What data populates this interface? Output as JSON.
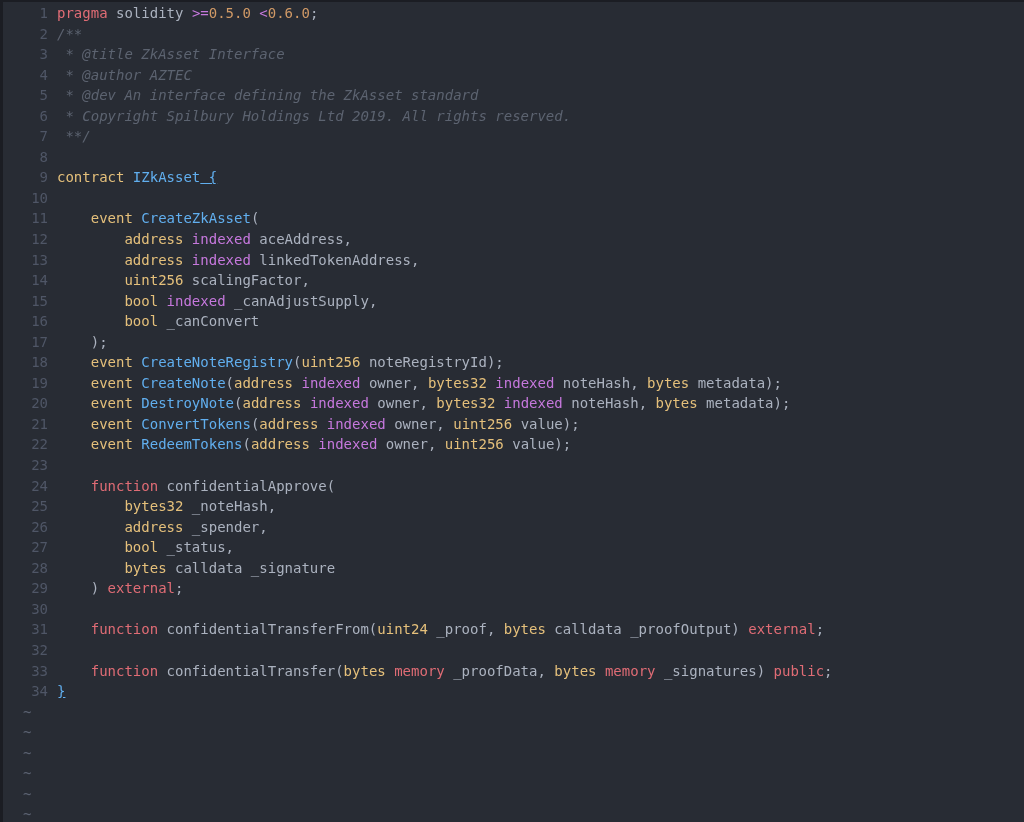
{
  "editor": {
    "lines": [
      {
        "number": "1",
        "tokens": [
          {
            "text": "pragma",
            "kind": "kw"
          },
          {
            "text": " solidity ",
            "kind": "plain"
          },
          {
            "text": ">=",
            "kind": "op"
          },
          {
            "text": "0.5.0",
            "kind": "num"
          },
          {
            "text": " <",
            "kind": "op"
          },
          {
            "text": "0.6.0",
            "kind": "num"
          },
          {
            "text": ";",
            "kind": "plain"
          }
        ]
      },
      {
        "number": "2",
        "tokens": [
          {
            "text": "/**",
            "kind": "comment"
          }
        ]
      },
      {
        "number": "3",
        "tokens": [
          {
            "text": " * @title ZkAsset Interface",
            "kind": "comment"
          }
        ]
      },
      {
        "number": "4",
        "tokens": [
          {
            "text": " * @author AZTEC",
            "kind": "comment"
          }
        ]
      },
      {
        "number": "5",
        "tokens": [
          {
            "text": " * @dev An interface defining the ZkAsset standard",
            "kind": "comment"
          }
        ]
      },
      {
        "number": "6",
        "tokens": [
          {
            "text": " * Copyright Spilbury Holdings Ltd 2019. All rights reserved.",
            "kind": "comment"
          }
        ]
      },
      {
        "number": "7",
        "tokens": [
          {
            "text": " **/",
            "kind": "comment"
          }
        ]
      },
      {
        "number": "8"
      },
      {
        "number": "9",
        "tokens": [
          {
            "text": "contract",
            "kind": "type"
          },
          {
            "text": " IZkAsset",
            "kind": "fn"
          },
          {
            "text": " {",
            "kind": "brace"
          }
        ]
      },
      {
        "number": "10"
      },
      {
        "number": "11",
        "tokens": [
          {
            "text": "    event",
            "kind": "type"
          },
          {
            "text": " CreateZkAsset",
            "kind": "fn"
          },
          {
            "text": "(",
            "kind": "plain"
          }
        ]
      },
      {
        "number": "12",
        "tokens": [
          {
            "text": "        address",
            "kind": "type"
          },
          {
            "text": " indexed",
            "kind": "mod"
          },
          {
            "text": " aceAddress,",
            "kind": "plain"
          }
        ]
      },
      {
        "number": "13",
        "tokens": [
          {
            "text": "        address",
            "kind": "type"
          },
          {
            "text": " indexed",
            "kind": "mod"
          },
          {
            "text": " linkedTokenAddress,",
            "kind": "plain"
          }
        ]
      },
      {
        "number": "14",
        "tokens": [
          {
            "text": "        uint256",
            "kind": "type"
          },
          {
            "text": " scalingFactor,",
            "kind": "plain"
          }
        ]
      },
      {
        "number": "15",
        "tokens": [
          {
            "text": "        bool",
            "kind": "type"
          },
          {
            "text": " indexed",
            "kind": "mod"
          },
          {
            "text": " _canAdjustSupply,",
            "kind": "plain"
          }
        ]
      },
      {
        "number": "16",
        "tokens": [
          {
            "text": "        bool",
            "kind": "type"
          },
          {
            "text": " _canConvert",
            "kind": "plain"
          }
        ]
      },
      {
        "number": "17",
        "tokens": [
          {
            "text": "    );",
            "kind": "plain"
          }
        ]
      },
      {
        "number": "18",
        "tokens": [
          {
            "text": "    event",
            "kind": "type"
          },
          {
            "text": " CreateNoteRegistry",
            "kind": "fn"
          },
          {
            "text": "(",
            "kind": "plain"
          },
          {
            "text": "uint256",
            "kind": "type"
          },
          {
            "text": " noteRegistryId);",
            "kind": "plain"
          }
        ]
      },
      {
        "number": "19",
        "tokens": [
          {
            "text": "    event",
            "kind": "type"
          },
          {
            "text": " CreateNote",
            "kind": "fn"
          },
          {
            "text": "(",
            "kind": "plain"
          },
          {
            "text": "address",
            "kind": "type"
          },
          {
            "text": " indexed",
            "kind": "mod"
          },
          {
            "text": " owner, ",
            "kind": "plain"
          },
          {
            "text": "bytes32",
            "kind": "type"
          },
          {
            "text": " indexed",
            "kind": "mod"
          },
          {
            "text": " noteHash, ",
            "kind": "plain"
          },
          {
            "text": "bytes",
            "kind": "type"
          },
          {
            "text": " metadata);",
            "kind": "plain"
          }
        ]
      },
      {
        "number": "20",
        "tokens": [
          {
            "text": "    event",
            "kind": "type"
          },
          {
            "text": " DestroyNote",
            "kind": "fn"
          },
          {
            "text": "(",
            "kind": "plain"
          },
          {
            "text": "address",
            "kind": "type"
          },
          {
            "text": " indexed",
            "kind": "mod"
          },
          {
            "text": " owner, ",
            "kind": "plain"
          },
          {
            "text": "bytes32",
            "kind": "type"
          },
          {
            "text": " indexed",
            "kind": "mod"
          },
          {
            "text": " noteHash, ",
            "kind": "plain"
          },
          {
            "text": "bytes",
            "kind": "type"
          },
          {
            "text": " metadata);",
            "kind": "plain"
          }
        ]
      },
      {
        "number": "21",
        "tokens": [
          {
            "text": "    event",
            "kind": "type"
          },
          {
            "text": " ConvertTokens",
            "kind": "fn"
          },
          {
            "text": "(",
            "kind": "plain"
          },
          {
            "text": "address",
            "kind": "type"
          },
          {
            "text": " indexed",
            "kind": "mod"
          },
          {
            "text": " owner, ",
            "kind": "plain"
          },
          {
            "text": "uint256",
            "kind": "type"
          },
          {
            "text": " value);",
            "kind": "plain"
          }
        ]
      },
      {
        "number": "22",
        "tokens": [
          {
            "text": "    event",
            "kind": "type"
          },
          {
            "text": " RedeemTokens",
            "kind": "fn"
          },
          {
            "text": "(",
            "kind": "plain"
          },
          {
            "text": "address",
            "kind": "type"
          },
          {
            "text": " indexed",
            "kind": "mod"
          },
          {
            "text": " owner, ",
            "kind": "plain"
          },
          {
            "text": "uint256",
            "kind": "type"
          },
          {
            "text": " value);",
            "kind": "plain"
          }
        ]
      },
      {
        "number": "23"
      },
      {
        "number": "24",
        "tokens": [
          {
            "text": "    function",
            "kind": "kw"
          },
          {
            "text": " confidentialApprove(",
            "kind": "plain"
          }
        ]
      },
      {
        "number": "25",
        "tokens": [
          {
            "text": "        bytes32",
            "kind": "type"
          },
          {
            "text": " _noteHash,",
            "kind": "plain"
          }
        ]
      },
      {
        "number": "26",
        "tokens": [
          {
            "text": "        address",
            "kind": "type"
          },
          {
            "text": " _spender,",
            "kind": "plain"
          }
        ]
      },
      {
        "number": "27",
        "tokens": [
          {
            "text": "        bool",
            "kind": "type"
          },
          {
            "text": " _status,",
            "kind": "plain"
          }
        ]
      },
      {
        "number": "28",
        "tokens": [
          {
            "text": "        bytes",
            "kind": "type"
          },
          {
            "text": " calldata _signature",
            "kind": "plain"
          }
        ]
      },
      {
        "number": "29",
        "tokens": [
          {
            "text": "    )",
            "kind": "plain"
          },
          {
            "text": " external",
            "kind": "kw"
          },
          {
            "text": ";",
            "kind": "plain"
          }
        ]
      },
      {
        "number": "30"
      },
      {
        "number": "31",
        "tokens": [
          {
            "text": "    function",
            "kind": "kw"
          },
          {
            "text": " confidentialTransferFrom(",
            "kind": "plain"
          },
          {
            "text": "uint24",
            "kind": "type"
          },
          {
            "text": " _proof, ",
            "kind": "plain"
          },
          {
            "text": "bytes",
            "kind": "type"
          },
          {
            "text": " calldata _proofOutput)",
            "kind": "plain"
          },
          {
            "text": " external",
            "kind": "kw"
          },
          {
            "text": ";",
            "kind": "plain"
          }
        ]
      },
      {
        "number": "32"
      },
      {
        "number": "33",
        "tokens": [
          {
            "text": "    function",
            "kind": "kw"
          },
          {
            "text": " confidentialTransfer(",
            "kind": "plain"
          },
          {
            "text": "bytes",
            "kind": "type"
          },
          {
            "text": " memory",
            "kind": "kw"
          },
          {
            "text": " _proofData, ",
            "kind": "plain"
          },
          {
            "text": "bytes",
            "kind": "type"
          },
          {
            "text": " memory",
            "kind": "kw"
          },
          {
            "text": " _signatures)",
            "kind": "plain"
          },
          {
            "text": " public",
            "kind": "kw"
          },
          {
            "text": ";",
            "kind": "plain"
          }
        ]
      },
      {
        "number": "34",
        "tokens": [
          {
            "text": "}",
            "kind": "brace"
          }
        ]
      }
    ],
    "empty_line_markers": [
      "~",
      "~",
      "~",
      "~",
      "~",
      "~"
    ]
  }
}
